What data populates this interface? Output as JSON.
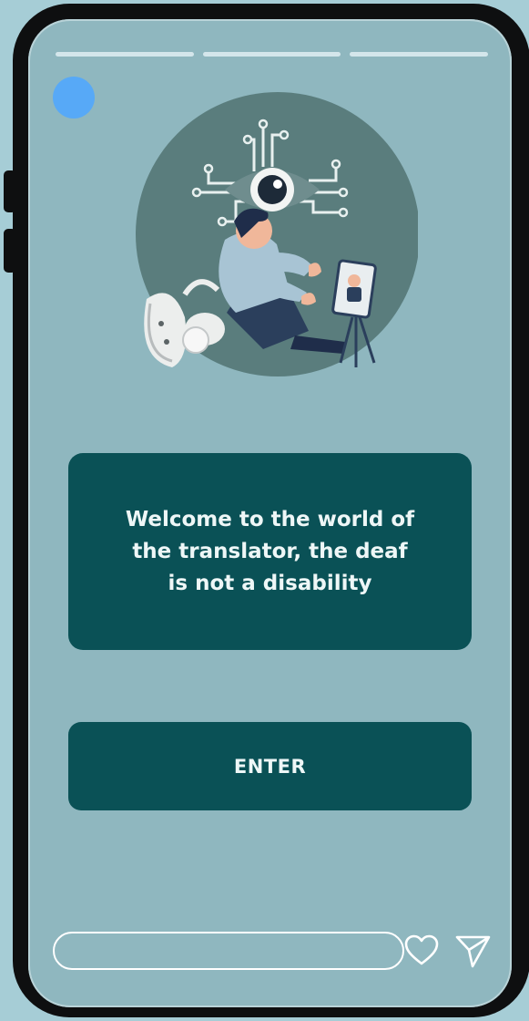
{
  "story": {
    "progress_segments": 3,
    "welcome_message": "Welcome to the world of the translator, the deaf is not a disability",
    "enter_label": "ENTER",
    "reply_placeholder": ""
  },
  "icons": {
    "avatar": "avatar-circle",
    "illustration": "sign-language-illustration",
    "like": "heart-icon",
    "send": "send-icon"
  },
  "colors": {
    "background": "#a6cdd6",
    "screen": "#8fb7bf",
    "accent": "#0a5156",
    "avatar": "#57a9f7",
    "illustration_circle": "#5a7d7d"
  }
}
